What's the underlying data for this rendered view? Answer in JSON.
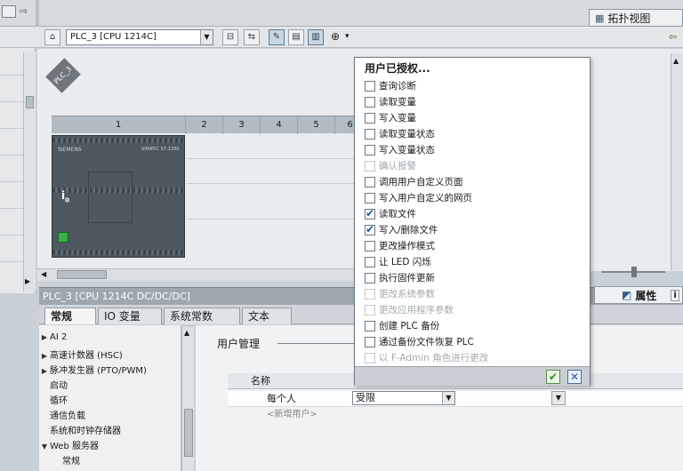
{
  "topbar": {
    "topology_view": "拓扑视图"
  },
  "toolbar": {
    "device_selected": "PLC_3 [CPU 1214C]"
  },
  "canvas": {
    "plc_tag": "PLC_3",
    "slot_numbers": [
      "1",
      "2",
      "3",
      "4",
      "5",
      "6"
    ],
    "cpu_brand": "SIEMENS",
    "cpu_model": "SIMATIC S7-1200"
  },
  "popup": {
    "title": "用户已授权...",
    "items": [
      {
        "label": "查询诊断",
        "checked": false,
        "enabled": true
      },
      {
        "label": "读取变量",
        "checked": false,
        "enabled": true
      },
      {
        "label": "写入变量",
        "checked": false,
        "enabled": true
      },
      {
        "label": "读取变量状态",
        "checked": false,
        "enabled": true
      },
      {
        "label": "写入变量状态",
        "checked": false,
        "enabled": true
      },
      {
        "label": "确认报警",
        "checked": false,
        "enabled": false
      },
      {
        "label": "调用用户自定义页面",
        "checked": false,
        "enabled": true
      },
      {
        "label": "写入用户自定义的网页",
        "checked": false,
        "enabled": true
      },
      {
        "label": "读取文件",
        "checked": true,
        "enabled": true
      },
      {
        "label": "写入/删除文件",
        "checked": true,
        "enabled": true
      },
      {
        "label": "更改操作模式",
        "checked": false,
        "enabled": true
      },
      {
        "label": "让 LED 闪烁",
        "checked": false,
        "enabled": true
      },
      {
        "label": "执行固件更新",
        "checked": false,
        "enabled": true
      },
      {
        "label": "更改系统参数",
        "checked": false,
        "enabled": false
      },
      {
        "label": "更改应用程序参数",
        "checked": false,
        "enabled": false
      },
      {
        "label": "创建 PLC 备份",
        "checked": false,
        "enabled": true
      },
      {
        "label": "通过备份文件恢复 PLC",
        "checked": false,
        "enabled": true
      },
      {
        "label": "以 F-Admin 角色进行更改",
        "checked": false,
        "enabled": false
      }
    ]
  },
  "inspector": {
    "title": "PLC_3 [CPU 1214C DC/DC/DC]",
    "properties_tab": "属性",
    "tabs": [
      "常规",
      "IO 变量",
      "系统常数",
      "文本"
    ],
    "nav": [
      {
        "label": "AI 2",
        "arrow": "▶"
      },
      {
        "label": "高速计数器 (HSC)",
        "arrow": "▶"
      },
      {
        "label": "脉冲发生器 (PTO/PWM)",
        "arrow": "▶"
      },
      {
        "label": "启动",
        "arrow": ""
      },
      {
        "label": "循环",
        "arrow": ""
      },
      {
        "label": "通信负载",
        "arrow": ""
      },
      {
        "label": "系统和时钟存储器",
        "arrow": ""
      },
      {
        "label": "Web 服务器",
        "arrow": "▼"
      },
      {
        "label": "常规",
        "arrow": ""
      }
    ],
    "section_title": "用户管理",
    "table": {
      "col_name": "名称",
      "row_user": "每个人",
      "row_rights": "受限",
      "new_user": "<新增用户>"
    }
  }
}
